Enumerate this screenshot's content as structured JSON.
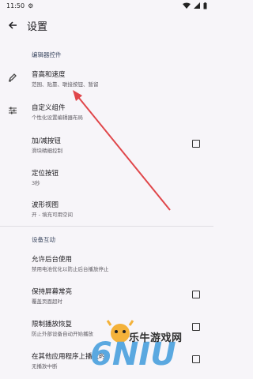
{
  "status_bar": {
    "time": "11:50"
  },
  "app_bar": {
    "title": "设置"
  },
  "sections": [
    {
      "header": "编辑器控件"
    },
    {
      "header": "设备互动"
    }
  ],
  "rows": [
    {
      "title": "音高和速度",
      "subtitle": "范围、贴靠、联接按钮、暂留",
      "icon": "pencil-icon"
    },
    {
      "title": "自定义组件",
      "subtitle": "个性化设置编辑器布局",
      "icon": "sliders-icon"
    },
    {
      "title": "加/减按钮",
      "subtitle": "滑块精细控制",
      "checked": false
    },
    {
      "title": "定位按钮",
      "subtitle": "3秒"
    },
    {
      "title": "波形视图",
      "subtitle": "开 - 填充可用空间"
    },
    {
      "title": "允许后台使用",
      "subtitle": "禁用电池优化以防止后台播放停止"
    },
    {
      "title": "保持屏幕常亮",
      "subtitle": "覆盖页面超时",
      "checked": false
    },
    {
      "title": "限制播放恢复",
      "subtitle": "防止外部设备自动开始播放",
      "checked": false
    },
    {
      "title": "在其他应用程序上播放时",
      "subtitle": "无播放中断",
      "checked": false
    }
  ],
  "watermark": {
    "text": "乐牛游戏网",
    "logo": "6NIU"
  },
  "colors": {
    "arrow": "#e0464a",
    "background": "#f7f5f9",
    "section_header": "#3e4a63"
  }
}
